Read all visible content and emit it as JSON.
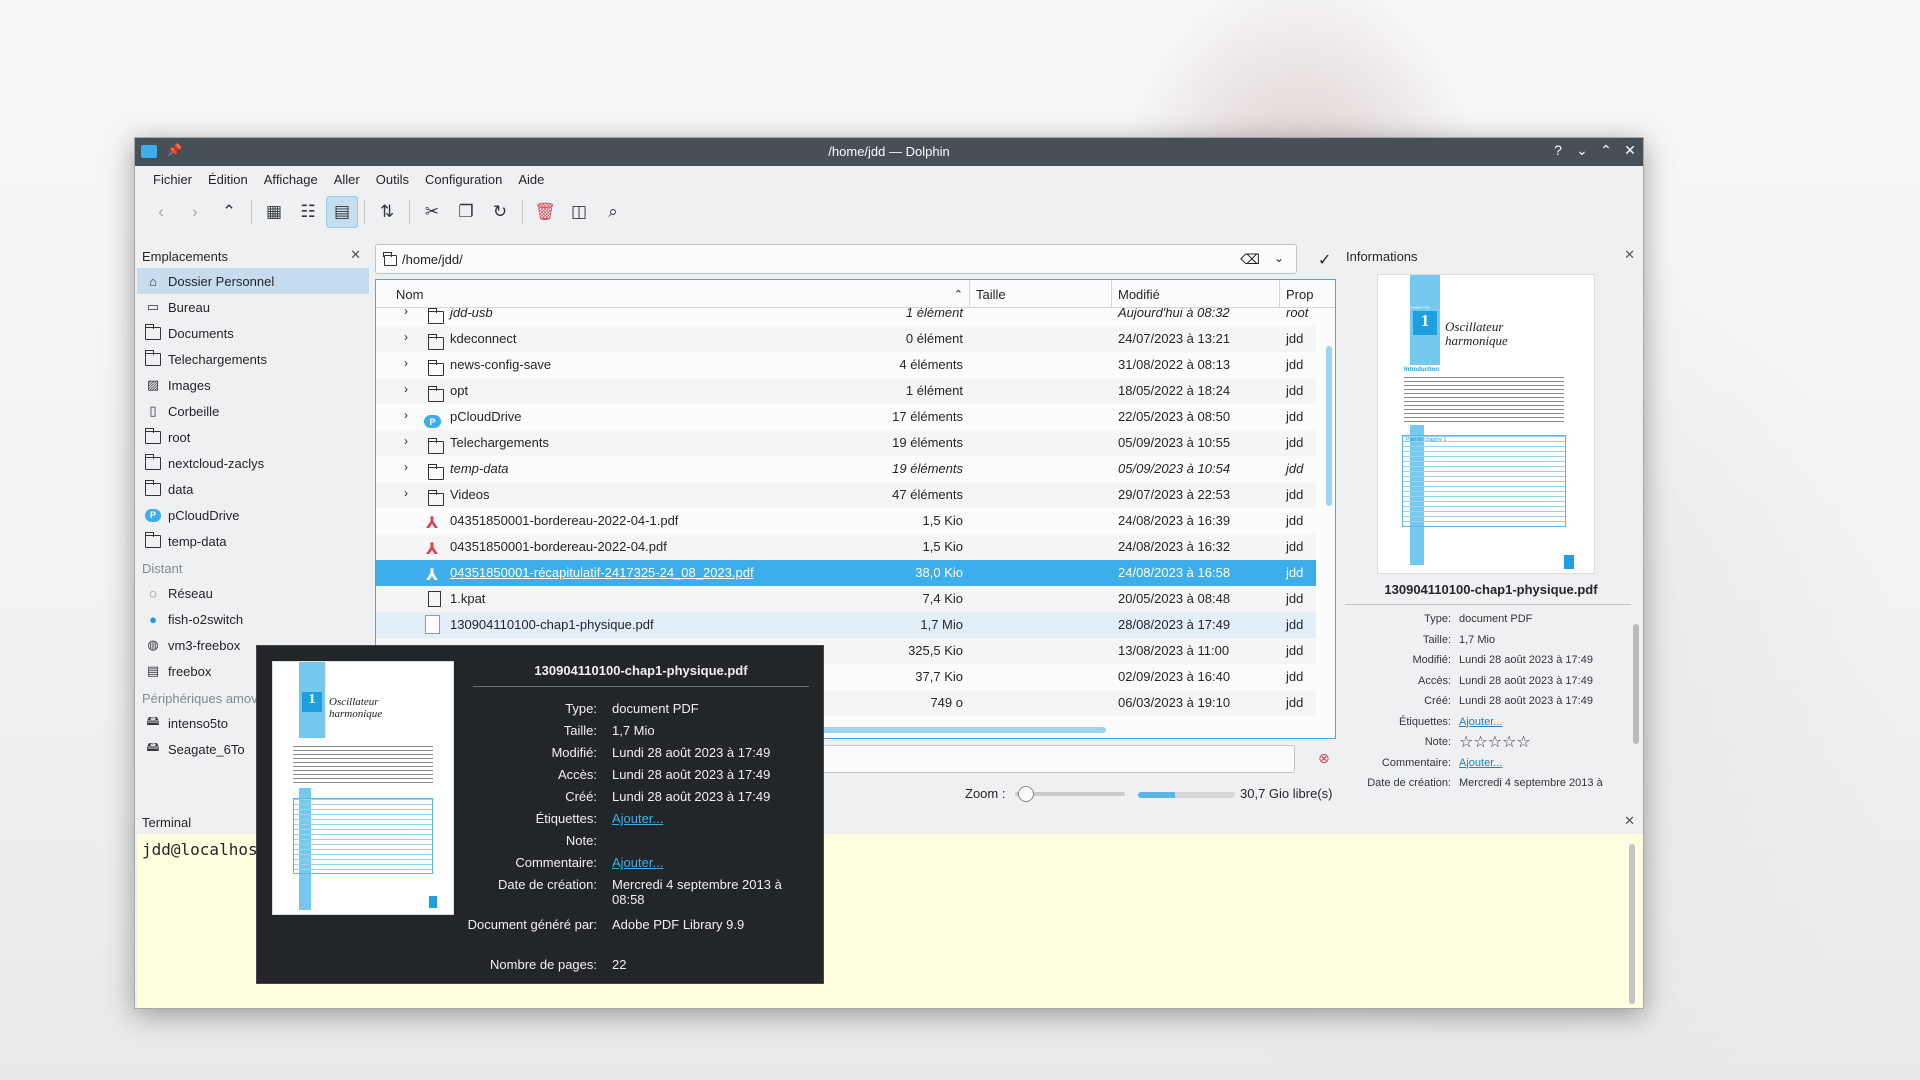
{
  "window": {
    "title": "/home/jdd — Dolphin",
    "controls": [
      "?",
      "⌄",
      "⌃",
      "✕"
    ]
  },
  "menu": [
    "Fichier",
    "Édition",
    "Affichage",
    "Aller",
    "Outils",
    "Configuration",
    "Aide"
  ],
  "places": {
    "title": "Emplacements",
    "items": [
      {
        "label": "Dossier Personnel",
        "icon": "home-icon"
      },
      {
        "label": "Bureau",
        "icon": "desktop-icon"
      },
      {
        "label": "Documents",
        "icon": "folder-icon"
      },
      {
        "label": "Telechargements",
        "icon": "folder-icon"
      },
      {
        "label": "Images",
        "icon": "image-icon"
      },
      {
        "label": "Corbeille",
        "icon": "trash-icon"
      },
      {
        "label": "root",
        "icon": "folder-icon"
      },
      {
        "label": "nextcloud-zaclys",
        "icon": "folder-icon"
      },
      {
        "label": "data",
        "icon": "folder-icon"
      },
      {
        "label": "pCloudDrive",
        "icon": "cloud-icon"
      },
      {
        "label": "temp-data",
        "icon": "folder-icon"
      }
    ],
    "remote_title": "Distant",
    "remote": [
      {
        "label": "Réseau",
        "icon": "network-icon"
      },
      {
        "label": "fish-o2switch",
        "icon": "globe-icon"
      },
      {
        "label": "vm3-freebox",
        "icon": "network-icon"
      },
      {
        "label": "freebox",
        "icon": "server-icon"
      }
    ],
    "devices_title": "Périphériques amovibles",
    "devices": [
      {
        "label": "intenso5to",
        "icon": "usb-drive-icon"
      },
      {
        "label": "Seagate_6To",
        "icon": "usb-drive-icon"
      }
    ]
  },
  "location": {
    "path": "/home/jdd/"
  },
  "columns": {
    "name": "Nom",
    "size": "Taille",
    "modified": "Modifié",
    "owner": "Prop"
  },
  "files": [
    {
      "name": "jdd-usb",
      "size": "1 élément",
      "modified": "Aujourd'hui à 08:32",
      "owner": "root",
      "type": "folder",
      "italic": true
    },
    {
      "name": "kdeconnect",
      "size": "0 élément",
      "modified": "24/07/2023 à 13:21",
      "owner": "jdd",
      "type": "folder"
    },
    {
      "name": "news-config-save",
      "size": "4 éléments",
      "modified": "31/08/2022 à 08:13",
      "owner": "jdd",
      "type": "folder"
    },
    {
      "name": "opt",
      "size": "1 élément",
      "modified": "18/05/2022 à 18:24",
      "owner": "jdd",
      "type": "folder"
    },
    {
      "name": "pCloudDrive",
      "size": "17 éléments",
      "modified": "22/05/2023 à 08:50",
      "owner": "jdd",
      "type": "cloud"
    },
    {
      "name": "Telechargements",
      "size": "19 éléments",
      "modified": "05/09/2023 à 10:55",
      "owner": "jdd",
      "type": "folder"
    },
    {
      "name": "temp-data",
      "size": "19 éléments",
      "modified": "05/09/2023 à 10:54",
      "owner": "jdd",
      "type": "folder",
      "italic": true
    },
    {
      "name": "Videos",
      "size": "47 éléments",
      "modified": "29/07/2023 à 22:53",
      "owner": "jdd",
      "type": "folder"
    },
    {
      "name": "04351850001-bordereau-2022-04-1.pdf",
      "size": "1,5 Kio",
      "modified": "24/08/2023 à 16:39",
      "owner": "jdd",
      "type": "pdf"
    },
    {
      "name": "04351850001-bordereau-2022-04.pdf",
      "size": "1,5 Kio",
      "modified": "24/08/2023 à 16:32",
      "owner": "jdd",
      "type": "pdf"
    },
    {
      "name": "04351850001-récapitulatif-2417325-24_08_2023.pdf",
      "size": "38,0 Kio",
      "modified": "24/08/2023 à 16:58",
      "owner": "jdd",
      "type": "pdf"
    },
    {
      "name": "1.kpat",
      "size": "7,4 Kio",
      "modified": "20/05/2023 à 08:48",
      "owner": "jdd",
      "type": "file"
    },
    {
      "name": "130904110100-chap1-physique.pdf",
      "size": "1,7 Mio",
      "modified": "28/08/2023 à 17:49",
      "owner": "jdd",
      "type": "pdfthumb"
    },
    {
      "name": "",
      "size": "325,5 Kio",
      "modified": "13/08/2023 à 11:00",
      "owner": "jdd",
      "type": "hidden"
    },
    {
      "name": "",
      "size": "37,7 Kio",
      "modified": "02/09/2023 à 16:40",
      "owner": "jdd",
      "type": "hidden"
    },
    {
      "name": "",
      "size": "749 o",
      "modified": "06/03/2023 à 19:10",
      "owner": "jdd",
      "type": "hidden"
    }
  ],
  "status": {
    "zoom_label": "Zoom :",
    "zoom_level": 0.1,
    "free_space": "30,7 Gio libre(s)",
    "free_fraction": 0.38
  },
  "info": {
    "title": "Informations",
    "filename": "130904110100-chap1-physique.pdf",
    "rows": [
      {
        "k": "Type:",
        "v": "document PDF"
      },
      {
        "k": "Taille:",
        "v": "1,7 Mio"
      },
      {
        "k": "Modifié:",
        "v": "Lundi 28 août 2023 à 17:49"
      },
      {
        "k": "Accès:",
        "v": "Lundi 28 août 2023 à 17:49"
      },
      {
        "k": "Créé:",
        "v": "Lundi 28 août 2023 à 17:49"
      },
      {
        "k": "Étiquettes:",
        "v": "Ajouter..."
      },
      {
        "k": "Note:",
        "v": "☆☆☆☆☆"
      },
      {
        "k": "Commentaire:",
        "v": "Ajouter..."
      },
      {
        "k": "Date de création:",
        "v": "Mercredi 4 septembre 2013 à"
      }
    ]
  },
  "thumb": {
    "chapter": "CHAPITRE",
    "num": "1",
    "title1": "Oscillateur",
    "title2": "harmonique",
    "intro": "Introduction",
    "plan": "Plan du chapitre 1"
  },
  "terminal": {
    "title": "Terminal",
    "prompt": "jdd@localhost"
  },
  "tooltip": {
    "filename": "130904110100-chap1-physique.pdf",
    "rows": [
      {
        "k": "Type:",
        "v": "document PDF"
      },
      {
        "k": "Taille:",
        "v": "1,7 Mio"
      },
      {
        "k": "Modifié:",
        "v": "Lundi 28 août 2023 à 17:49"
      },
      {
        "k": "Accès:",
        "v": "Lundi 28 août 2023 à 17:49"
      },
      {
        "k": "Créé:",
        "v": "Lundi 28 août 2023 à 17:49"
      },
      {
        "k": "Étiquettes:",
        "v": "Ajouter..."
      },
      {
        "k": "Note:",
        "v": ""
      },
      {
        "k": "Commentaire:",
        "v": "Ajouter..."
      },
      {
        "k": "Date de création:",
        "v": "Mercredi 4 septembre 2013 à 08:58"
      },
      {
        "k": "Document généré par:",
        "v": "Adobe PDF Library 9.9"
      },
      {
        "k": "Nombre de pages:",
        "v": "22"
      }
    ]
  }
}
